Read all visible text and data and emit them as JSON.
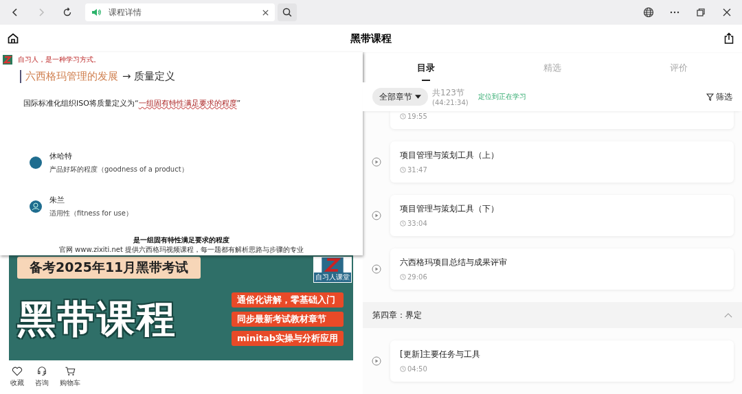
{
  "browser": {
    "tab_title": "课程详情"
  },
  "header": {
    "title": "黑带课程"
  },
  "video": {
    "slogan": "自习人，是一种学习方式。",
    "slide_title": "六西格玛管理的发展",
    "slide_title_rest": "→ 质量定义",
    "definition_prefix": "国际标准化组织ISO将质量定义为“",
    "definition_quote": "一组固有特性满足要求的程度",
    "definition_suffix": "”",
    "people": [
      {
        "name": "休哈特",
        "definition": "产品好坏的程度（goodness of a product）"
      },
      {
        "name": "朱兰",
        "definition": "适用性（fitness for use）"
      }
    ],
    "subtitle": "是一组固有特性满足要求的程度",
    "marquee": "官网 www.zixiti.net   提供六西格玛视频课程，每一题都有解析思路与步骤的专业"
  },
  "banner": {
    "headline": "备考2025年11月黑带考试",
    "title": "黑带课程",
    "logo_caption": "自习人课堂",
    "features": [
      "通俗化讲解，零基础入门",
      "同步最新考试教材章节",
      "minitab实操与分析应用"
    ]
  },
  "actions": [
    {
      "kind": "heart",
      "label": "收藏"
    },
    {
      "kind": "headset",
      "label": "咨询"
    },
    {
      "kind": "cart",
      "label": "购物车"
    }
  ],
  "tabs": [
    {
      "label": "目录",
      "selected": true
    },
    {
      "label": "精选",
      "selected": false
    },
    {
      "label": "评价",
      "selected": false
    }
  ],
  "filter": {
    "chapter_button": "全部章节",
    "count": "共123节",
    "total_duration": "(44:21:34)",
    "locate_link": "定位到正在学习",
    "filter_button": "筛选"
  },
  "items": [
    {
      "kind": "lesson",
      "duration": "19:55"
    },
    {
      "kind": "lesson",
      "title": "项目管理与策划工具（上）",
      "duration": "31:47"
    },
    {
      "kind": "lesson",
      "title": "项目管理与策划工具（下）",
      "duration": "33:04"
    },
    {
      "kind": "lesson",
      "title": "六西格玛项目总结与成果评审",
      "duration": "29:06"
    },
    {
      "kind": "chapter",
      "title": "第四章：界定",
      "expanded": true
    },
    {
      "kind": "lesson",
      "title": "[更新]主要任务与工具",
      "duration": "04:50"
    }
  ]
}
